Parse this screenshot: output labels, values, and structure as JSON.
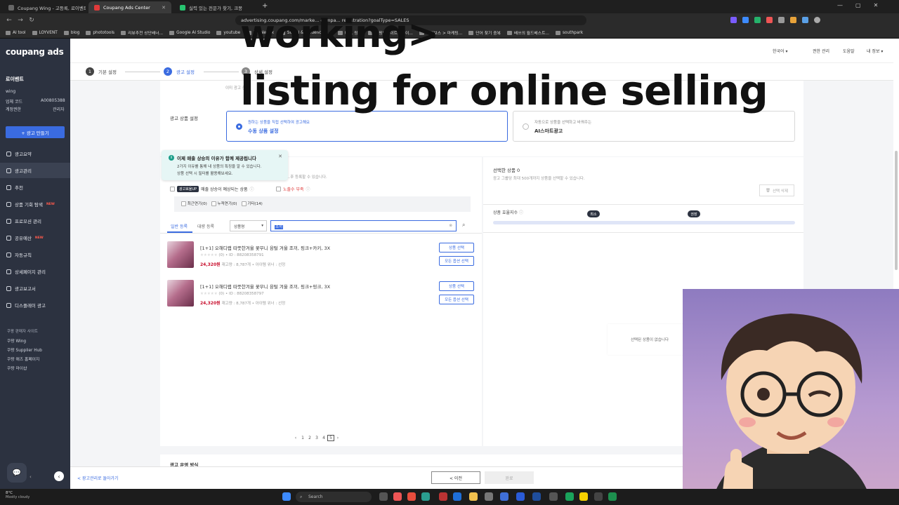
{
  "browser": {
    "tabs": [
      {
        "label": "Coupang Wing - 고등록, 로이벤트",
        "active": false,
        "favicon_color": "#666666"
      },
      {
        "label": "Coupang Ads Center",
        "active": true,
        "favicon_color": "#e03a3a"
      },
      {
        "label": "실력 있는 전문가 찾기, 크몽",
        "active": false,
        "favicon_color": "#27c36f"
      }
    ],
    "url": "advertising.coupang.com/marke... campa... registration?goalType=SALES",
    "bookmarks": [
      "AI tool",
      "LOYVENT",
      "blog",
      "phototools",
      "리뷰추천 상단배너...",
      "Google AI Studio",
      "youtube",
      "TopNetflix",
      "Social & Influencers...",
      "URL 링크",
      "쇼핑인사이트 : 네이...",
      "아이보스 > 마케팅...",
      "단어 찾기 중복",
      "배쓰의 월드베스트...",
      "southpark"
    ]
  },
  "sidebar": {
    "logo": "coupang ads",
    "store_name": "로이벤트",
    "account_label": "wing",
    "vendor_code_label": "업체 코드",
    "vendor_code": "A00805388",
    "permission_label": "계정권한",
    "permission": "관리자",
    "make_ad_button": "+ 광고 만들기",
    "menu": [
      {
        "label": "광고요약",
        "badge": ""
      },
      {
        "label": "광고관리",
        "badge": ""
      },
      {
        "label": "추천",
        "badge": ""
      },
      {
        "label": "상품 기회 탐색",
        "badge": "NEW"
      },
      {
        "label": "프로모션 관리",
        "badge": ""
      },
      {
        "label": "공유예산",
        "badge": "NEW"
      },
      {
        "label": "자동규칙",
        "badge": ""
      },
      {
        "label": "상세페이지 관리",
        "badge": ""
      },
      {
        "label": "광고보고서",
        "badge": ""
      },
      {
        "label": "디스플레이 광고",
        "badge": ""
      }
    ],
    "sites_title": "쿠팡 판매자 사이트",
    "sites": [
      "쿠팡 Wing",
      "쿠팡 Supplier Hub",
      "쿠팡 애즈 홈페이지",
      "쿠팡 마이샵"
    ]
  },
  "header": {
    "language": "한국어",
    "permission_mgmt": "권한 관리",
    "help": "도움말",
    "my_info": "내 정보"
  },
  "stepper": {
    "steps": [
      {
        "num": "1",
        "label": "기본 설정"
      },
      {
        "num": "2",
        "label": "광고 설정"
      },
      {
        "num": "3",
        "label": "상세 설정"
      }
    ]
  },
  "product_setting": {
    "title": "광고 상품 설정",
    "top_hint": "이미 광고 중...",
    "manual": {
      "desc": "원하는 상품을 직접 선택하여 광고해요",
      "label": "수동 상품 설정"
    },
    "ai": {
      "desc": "자동으로 상품을 선택하고 바꿔주는",
      "label": "AI스마트광고"
    }
  },
  "tooltip": {
    "title": "이제 매출 상승의 이유가 함께 제공됩니다",
    "line1": "2가지 이유를 통해 내 상품의 특징을 알 수 있습니다.",
    "line2": "상품 선택 시 필터를 활용해보세요."
  },
  "filters": {
    "hint": "...후 등록할 수 있습니다.",
    "badge": "광고효율UP",
    "sales_up": "매출 상승이 예상되는 상품",
    "exposure": "노출수 부족",
    "recent": "최근연기(0)",
    "cumulative": "누적연기(0)",
    "other": "기타(14)"
  },
  "list": {
    "tab_general": "일반 등록",
    "tab_bulk": "대량 등록",
    "search_type": "상품명",
    "search_value": "조끼",
    "products": [
      {
        "name": "[1+1] 오해디랩 따뜻한겨울 꽃무니 융털 겨울 조끼, 핑크+카키, 3X",
        "rating": "(0)",
        "id": "ID : 88208358791",
        "price": "24,320원",
        "meta": "재고량 : 8,787개 • 아이템 위너 : 선정"
      },
      {
        "name": "[1+1] 오해디랩 따뜻한겨울 꽃무니 융털 겨울 조끼, 핑크+핑크, 3X",
        "rating": "(0)",
        "id": "ID : 88208358797",
        "price": "24,320원",
        "meta": "재고량 : 8,787개 • 아이템 위너 : 선정"
      }
    ],
    "select_product": "상품 선택",
    "select_all_options": "모든 옵션 선택",
    "pages": [
      "1",
      "2",
      "3",
      "4",
      "5"
    ],
    "current_page": "5"
  },
  "selected": {
    "title": "선택한 상품",
    "count": "0",
    "hint": "광고 그룹당 최대 500개까지 상품을 선택할 수 있습니다.",
    "clear_button": "선택 삭제",
    "efficiency_label": "상품 효율지수",
    "marker_min": "최소",
    "marker_rec": "권장",
    "empty_text": "선택된 상품이 없습니다"
  },
  "operation": {
    "title": "광고 운영 방식"
  },
  "footer": {
    "back_link": "< 광고관리로 돌아가기",
    "prev": "< 이전",
    "done": "완료"
  },
  "overlay": {
    "line1": "working>",
    "line2": "listing for online selling"
  },
  "taskbar": {
    "weather_temp": "8°C",
    "weather_desc": "Mostly cloudy",
    "search": "Search"
  },
  "colors": {
    "accent": "#3a6be0",
    "sidebar": "#2c3240",
    "price": "#c8102e"
  }
}
